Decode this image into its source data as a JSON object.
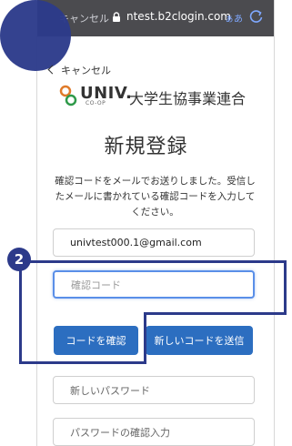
{
  "browser": {
    "cancel_label": "キャンセル",
    "host": "ntest.b2clogin.com",
    "text_size_label": "ぁあ"
  },
  "nav": {
    "back_label": "キャンセル"
  },
  "logo": {
    "univ": "UNIV.",
    "coop": "CO-OP",
    "org": "大学生協事業連合"
  },
  "page": {
    "title": "新規登録",
    "description": "確認コードをメールでお送りしました。受信したメールに書かれている確認コードを入力してください。"
  },
  "form": {
    "email_value": "univtest000.1@gmail.com",
    "code_placeholder": "確認コード",
    "verify_button": "コードを確認",
    "resend_button": "新しいコードを送信",
    "new_password_placeholder": "新しいパスワード",
    "confirm_password_placeholder": "パスワードの確認入力"
  },
  "annotation": {
    "step_number": "2"
  },
  "colors": {
    "urlbar": "#4b4b4f",
    "accent_button": "#2c6ec0",
    "annotation": "#2c3a8a",
    "focus_border": "#5a8fe8"
  }
}
